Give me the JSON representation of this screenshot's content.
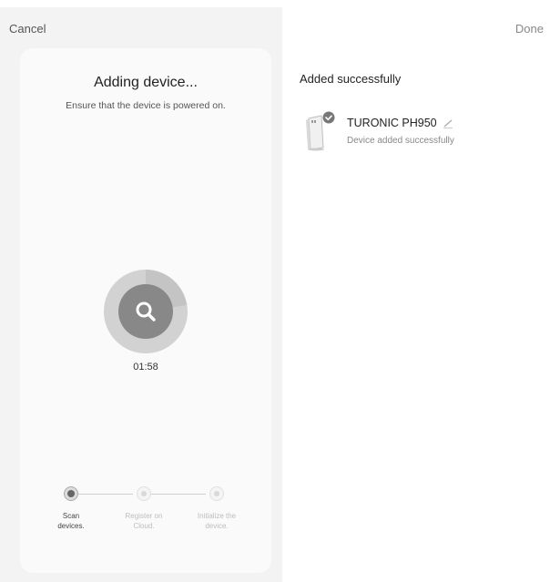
{
  "left": {
    "cancel_label": "Cancel",
    "title": "Adding device...",
    "subtitle": "Ensure that the device is powered on.",
    "timer": "01:58",
    "progress_icon": "search-icon",
    "steps": [
      {
        "label_line1": "Scan",
        "label_line2": "devices.",
        "state": "active"
      },
      {
        "label_line1": "Register on",
        "label_line2": "Cloud.",
        "state": "idle"
      },
      {
        "label_line1": "Initialize the",
        "label_line2": "device.",
        "state": "idle"
      }
    ]
  },
  "right": {
    "done_label": "Done",
    "section_title": "Added successfully",
    "device": {
      "name": "TURONIC PH950",
      "status": "Device added successfully",
      "icon": "air-purifier-icon",
      "badge_icon": "check-icon",
      "edit_icon": "pencil-icon"
    }
  },
  "colors": {
    "left_background": "#f3f3f3",
    "card_background": "#fafafa",
    "ring_outer": "#d2d2d2",
    "ring_progress": "#b8b8b8",
    "ring_inner": "#888888",
    "badge": "#777777"
  }
}
